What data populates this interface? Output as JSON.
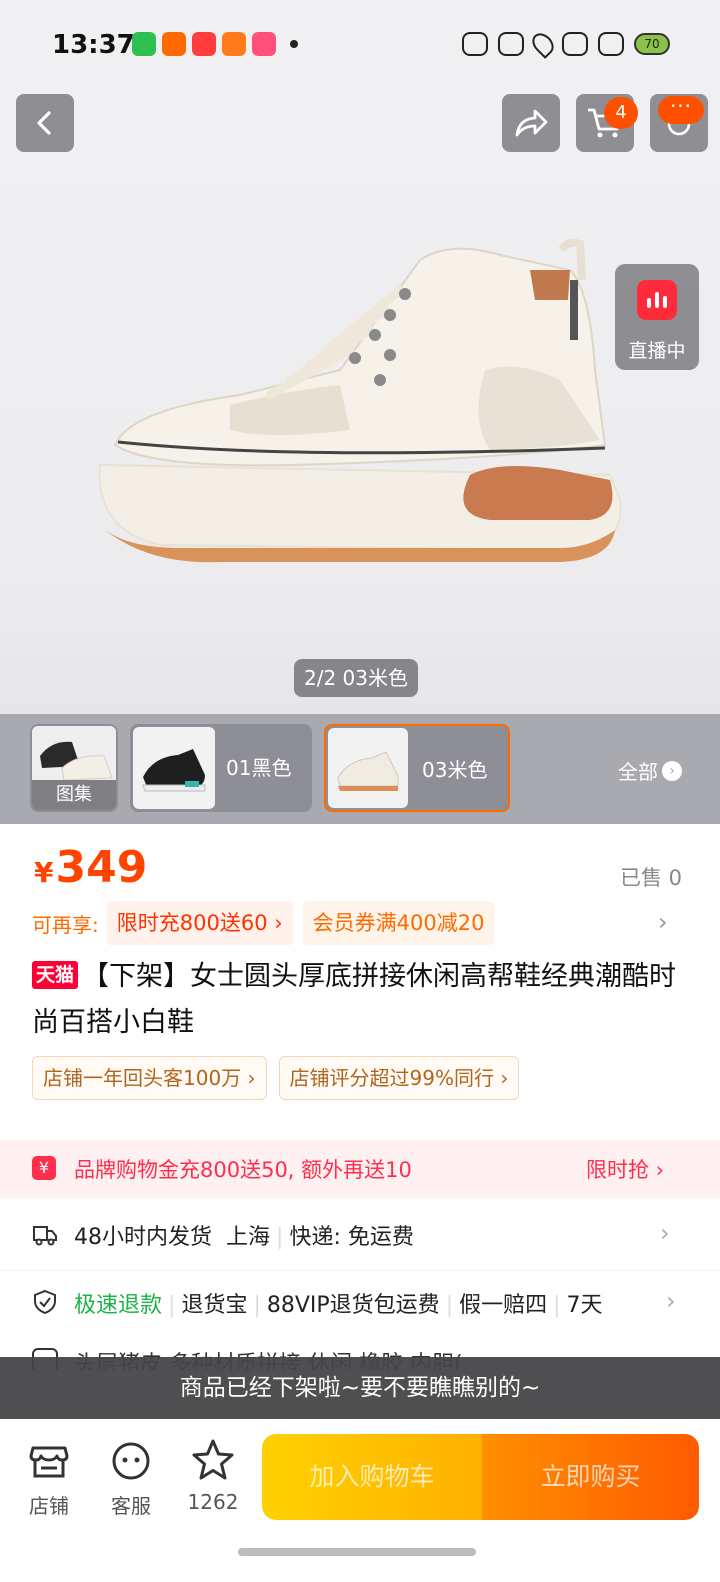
{
  "status_bar": {
    "time": "13:37",
    "battery": "70"
  },
  "hero": {
    "cart_count": "4",
    "more_label": "···",
    "live_label": "直播中",
    "image_counter": "2/2 03米色"
  },
  "variants": {
    "gallery_label": "图集",
    "items": [
      {
        "label": "01黑色"
      },
      {
        "label": "03米色"
      }
    ],
    "all_label": "全部"
  },
  "product": {
    "currency": "¥",
    "price": "349",
    "sold": "已售 0",
    "promo_lead": "可再享:",
    "promo_tags": [
      "限时充800送60 ›",
      "会员券满400减20"
    ],
    "tmall_badge": "天猫",
    "title": "【下架】女士圆头厚底拼接休闲高帮鞋经典潮酷时尚百搭小白鞋",
    "shop_tags": [
      "店铺一年回头客100万 ›",
      "店铺评分超过99%同行 ›"
    ]
  },
  "gold_banner": {
    "icon": "¥",
    "text": "品牌购物金充800送50, 额外再送10",
    "cta": "限时抢 ›"
  },
  "shipping": {
    "text1": "48小时内发货",
    "text2": "上海",
    "text3": "快递: 免运费"
  },
  "returns": {
    "fast": "极速退款",
    "items": [
      "退货宝",
      "88VIP退货包运费",
      "假一赔四",
      "7天"
    ]
  },
  "attributes": {
    "text": "头层猪皮  多种材质拼接  休闲  橡胶  内胆("
  },
  "toast": "商品已经下架啦~要不要瞧瞧别的~",
  "bottom_bar": {
    "store_label": "店铺",
    "service_label": "客服",
    "fav_count": "1262",
    "add_cart_label": "加入购物车",
    "buy_label": "立即购买"
  },
  "colors": {
    "accent": "#ff5000",
    "price": "#ff4400",
    "tmall": "#ff0036",
    "return_green": "#1db34a"
  }
}
